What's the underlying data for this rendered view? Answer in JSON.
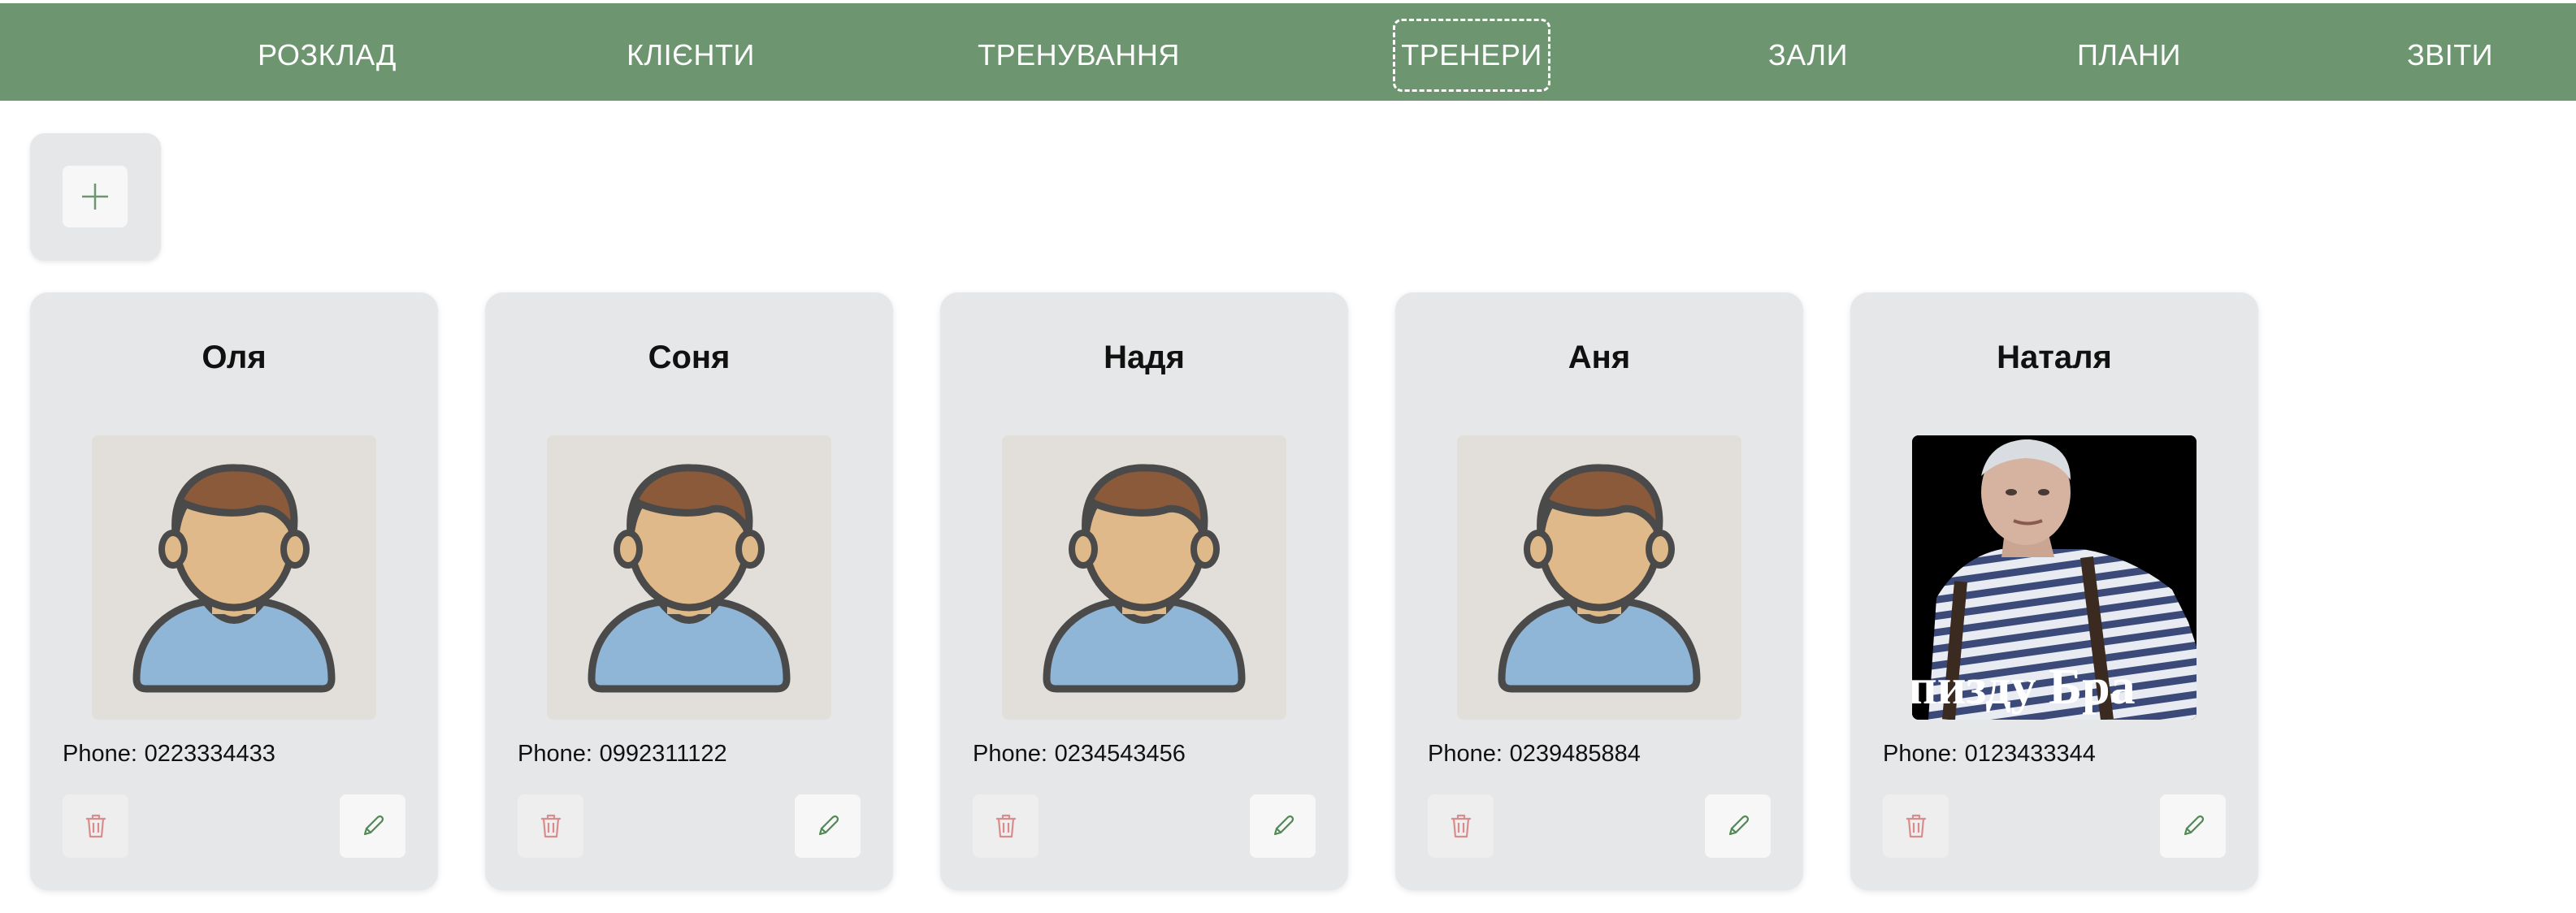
{
  "nav": {
    "items": [
      {
        "label": "РОЗКЛАД"
      },
      {
        "label": "КЛІЄНТИ"
      },
      {
        "label": "ТРЕНУВАННЯ"
      },
      {
        "label": "ТРЕНЕРИ",
        "active": true
      },
      {
        "label": "ЗАЛИ"
      },
      {
        "label": "ПЛАНИ"
      },
      {
        "label": "ЗВІТИ"
      }
    ]
  },
  "colors": {
    "nav_bg": "#6d9670",
    "card_bg": "#e6e7e8",
    "delete_icon": "#d98c8c",
    "edit_icon": "#4e8a52",
    "add_icon": "#6d9670"
  },
  "icons": {
    "add": "plus-icon",
    "delete": "trash-icon",
    "edit": "pencil-icon",
    "avatar": "user-avatar-placeholder"
  },
  "trainers": [
    {
      "name": "Оля",
      "phone_label": "Phone:",
      "phone": "0223334433",
      "photo": "avatar-placeholder"
    },
    {
      "name": "Соня",
      "phone_label": "Phone:",
      "phone": "0992311122",
      "photo": "avatar-placeholder"
    },
    {
      "name": "Надя",
      "phone_label": "Phone:",
      "phone": "0234543456",
      "photo": "avatar-placeholder"
    },
    {
      "name": "Аня",
      "phone_label": "Phone:",
      "phone": "0239485884",
      "photo": "avatar-placeholder"
    },
    {
      "name": "Наталя",
      "phone_label": "Phone:",
      "phone": "0123433344",
      "photo": "custom-photo",
      "photo_caption": "пизду Бра"
    }
  ]
}
